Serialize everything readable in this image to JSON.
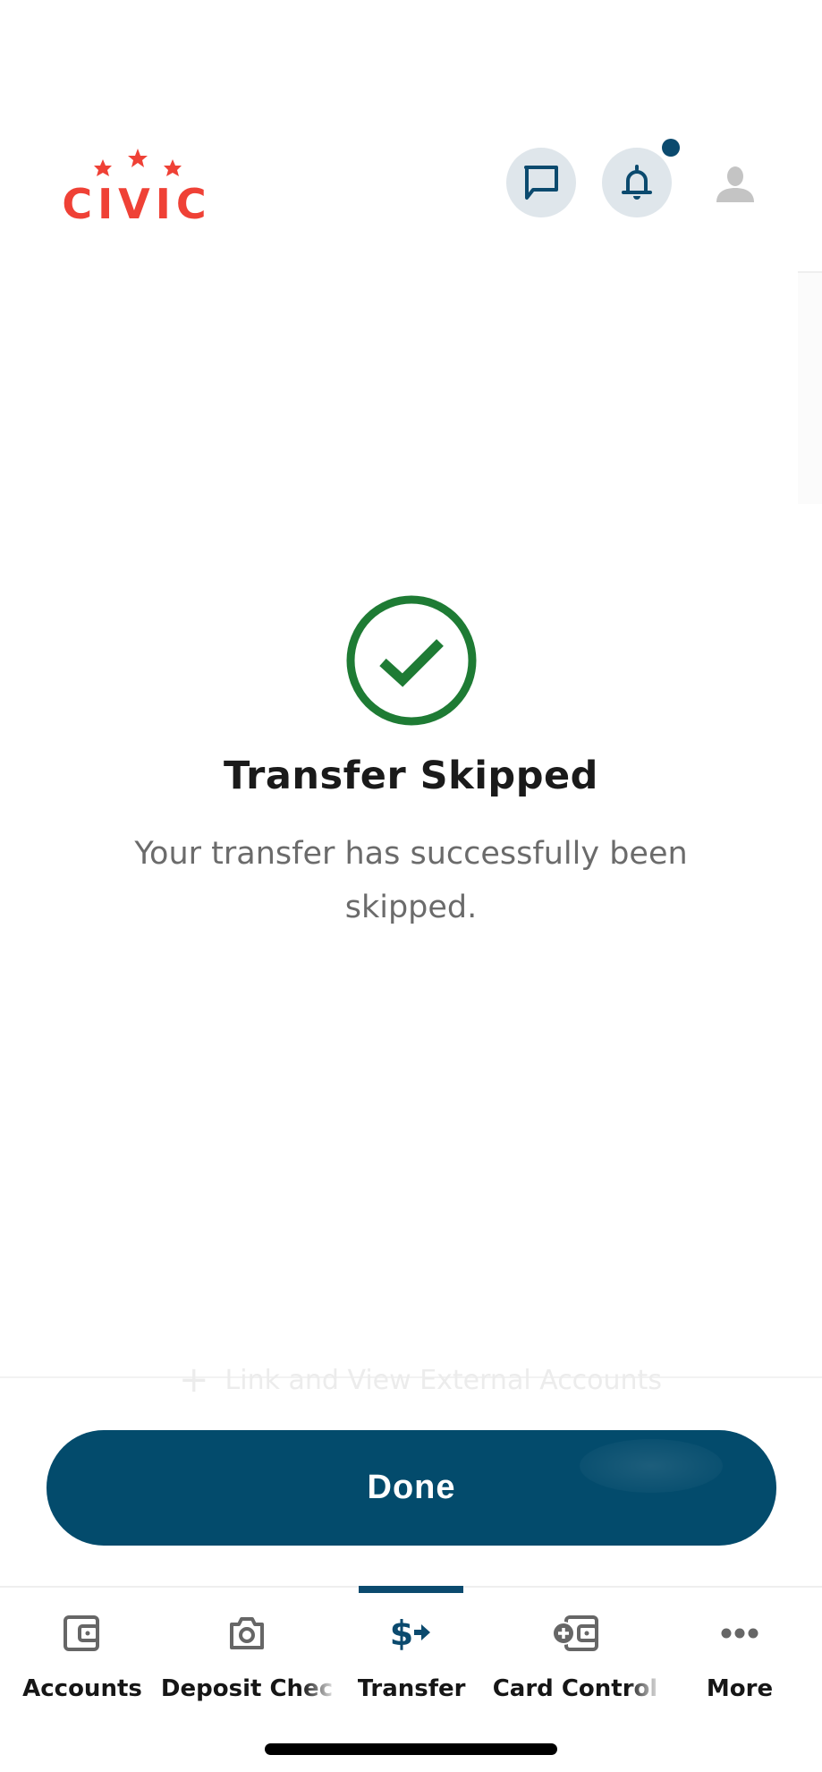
{
  "app": {
    "brand_name": "civic",
    "brand_color": "#ef4136",
    "accent_color": "#0b4a6e"
  },
  "header": {
    "logo_text": "CIVIC",
    "icons": [
      "chat-icon",
      "bell-icon",
      "profile-icon"
    ],
    "has_notification": true
  },
  "status": {
    "icon": "check-circle-icon",
    "icon_color": "#1e7b34",
    "title": "Transfer Skipped",
    "message": "Your transfer has successfully been skipped."
  },
  "background_link": {
    "icon": "plus-icon",
    "label": "Link and View External Accounts"
  },
  "actions": {
    "done_label": "Done"
  },
  "tabbar": {
    "active": "Transfer",
    "items": [
      {
        "label": "Accounts",
        "icon": "wallet-icon"
      },
      {
        "label": "Deposit Chec",
        "icon": "camera-icon"
      },
      {
        "label": "Transfer",
        "icon": "dollar-arrow-icon"
      },
      {
        "label": "Card Control",
        "icon": "card-control-icon"
      },
      {
        "label": "More",
        "icon": "more-dots-icon"
      }
    ]
  }
}
